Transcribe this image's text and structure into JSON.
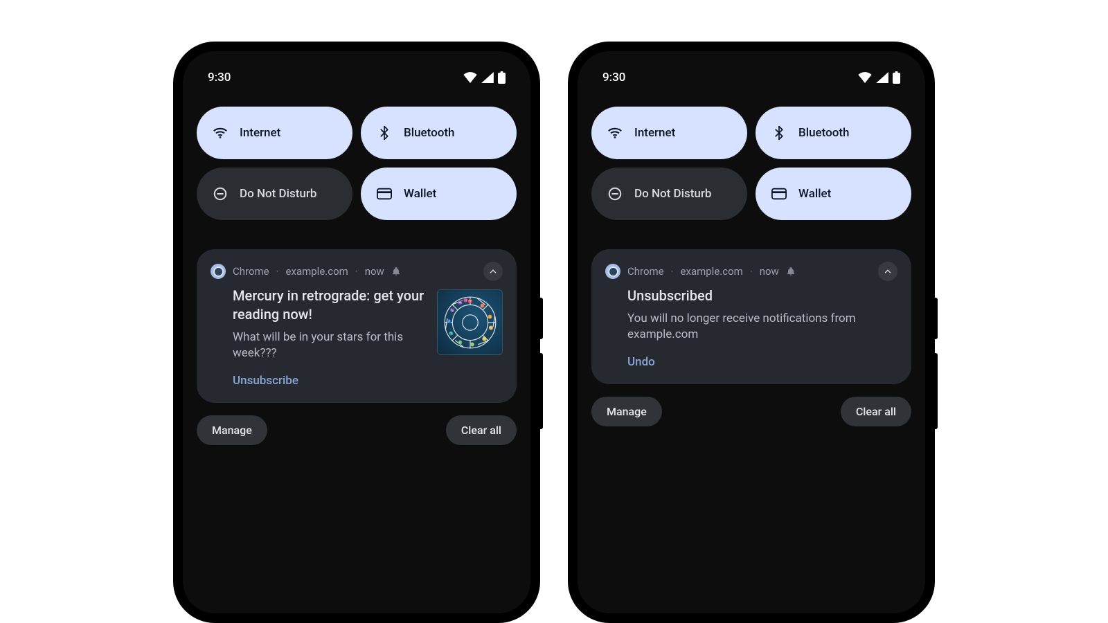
{
  "left": {
    "status": {
      "time": "9:30"
    },
    "qs": {
      "internet": "Internet",
      "bluetooth": "Bluetooth",
      "dnd": "Do Not Disturb",
      "wallet": "Wallet"
    },
    "notif": {
      "app": "Chrome",
      "site": "example.com",
      "when": "now",
      "title": "Mercury in retrograde: get your reading now!",
      "desc": "What will be in your stars for this week???",
      "action": "Unsubscribe"
    },
    "footer": {
      "manage": "Manage",
      "clear": "Clear all"
    }
  },
  "right": {
    "status": {
      "time": "9:30"
    },
    "qs": {
      "internet": "Internet",
      "bluetooth": "Bluetooth",
      "dnd": "Do Not Disturb",
      "wallet": "Wallet"
    },
    "notif": {
      "app": "Chrome",
      "site": "example.com",
      "when": "now",
      "title": "Unsubscribed",
      "desc": "You will no longer receive notifications from example.com",
      "action": "Undo"
    },
    "footer": {
      "manage": "Manage",
      "clear": "Clear all"
    }
  }
}
